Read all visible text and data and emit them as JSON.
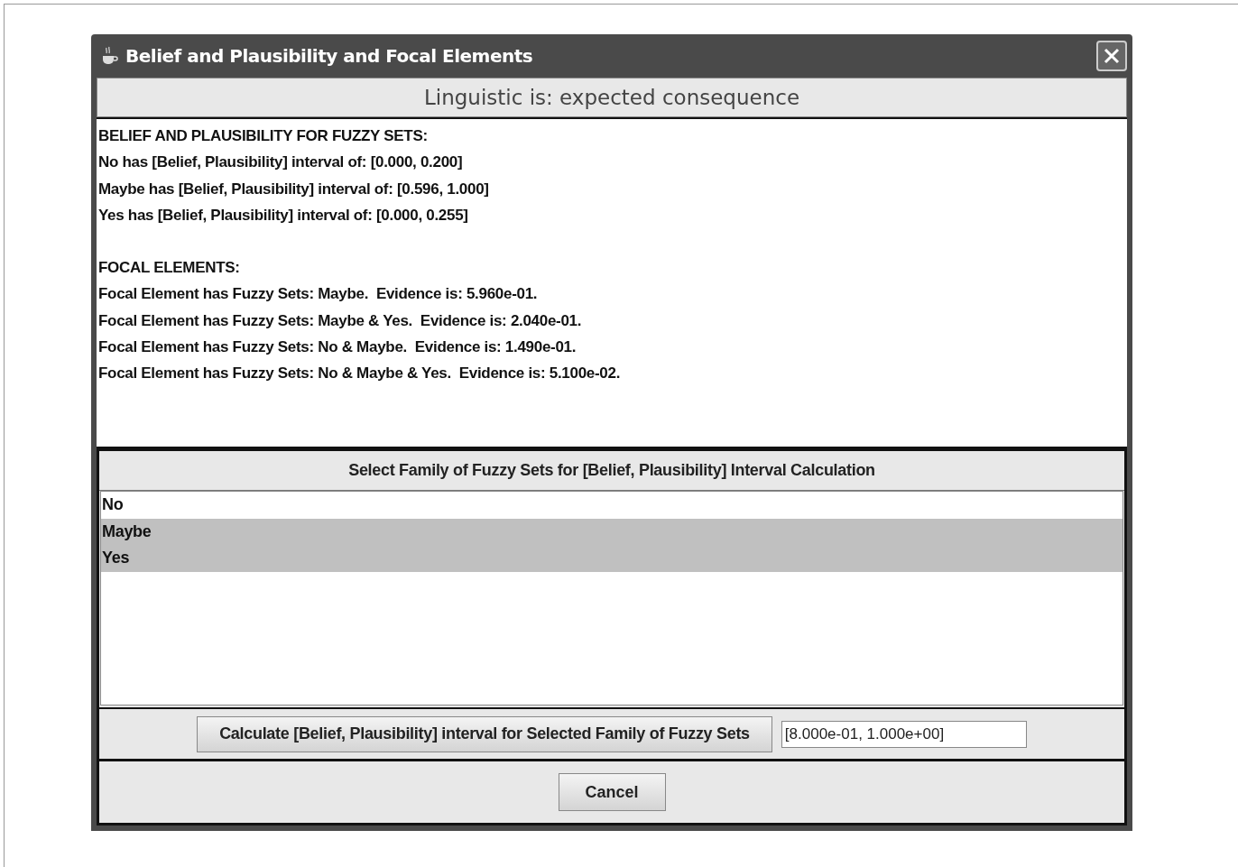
{
  "window": {
    "title": "Belief and Plausibility and Focal Elements"
  },
  "linguistic_label": "Linguistic is: expected consequence",
  "results": [
    {
      "heading": "BELIEF AND PLAUSIBILITY FOR FUZZY SETS:",
      "lines": [
        "No has [Belief, Plausibility] interval of: [0.000, 0.200]",
        "Maybe has [Belief, Plausibility] interval of: [0.596, 1.000]",
        "Yes has [Belief, Plausibility] interval of: [0.000, 0.255]"
      ]
    },
    {
      "heading": "FOCAL ELEMENTS:",
      "lines": [
        "Focal Element has Fuzzy Sets: Maybe.  Evidence is: 5.960e-01.",
        "Focal Element has Fuzzy Sets: Maybe & Yes.  Evidence is: 2.040e-01.",
        "Focal Element has Fuzzy Sets: No & Maybe.  Evidence is: 1.490e-01.",
        "Focal Element has Fuzzy Sets: No & Maybe & Yes.  Evidence is: 5.100e-02."
      ]
    }
  ],
  "family_list": {
    "header": "Select Family of Fuzzy Sets for [Belief, Plausibility] Interval Calculation",
    "items": [
      {
        "label": "No",
        "selected": false
      },
      {
        "label": "Maybe",
        "selected": true
      },
      {
        "label": "Yes",
        "selected": true
      }
    ]
  },
  "calculate_button": "Calculate [Belief, Plausibility] interval for Selected Family of Fuzzy Sets",
  "result_field": {
    "value": "[8.000e-01, 1.000e+00]"
  },
  "cancel_button": "Cancel"
}
